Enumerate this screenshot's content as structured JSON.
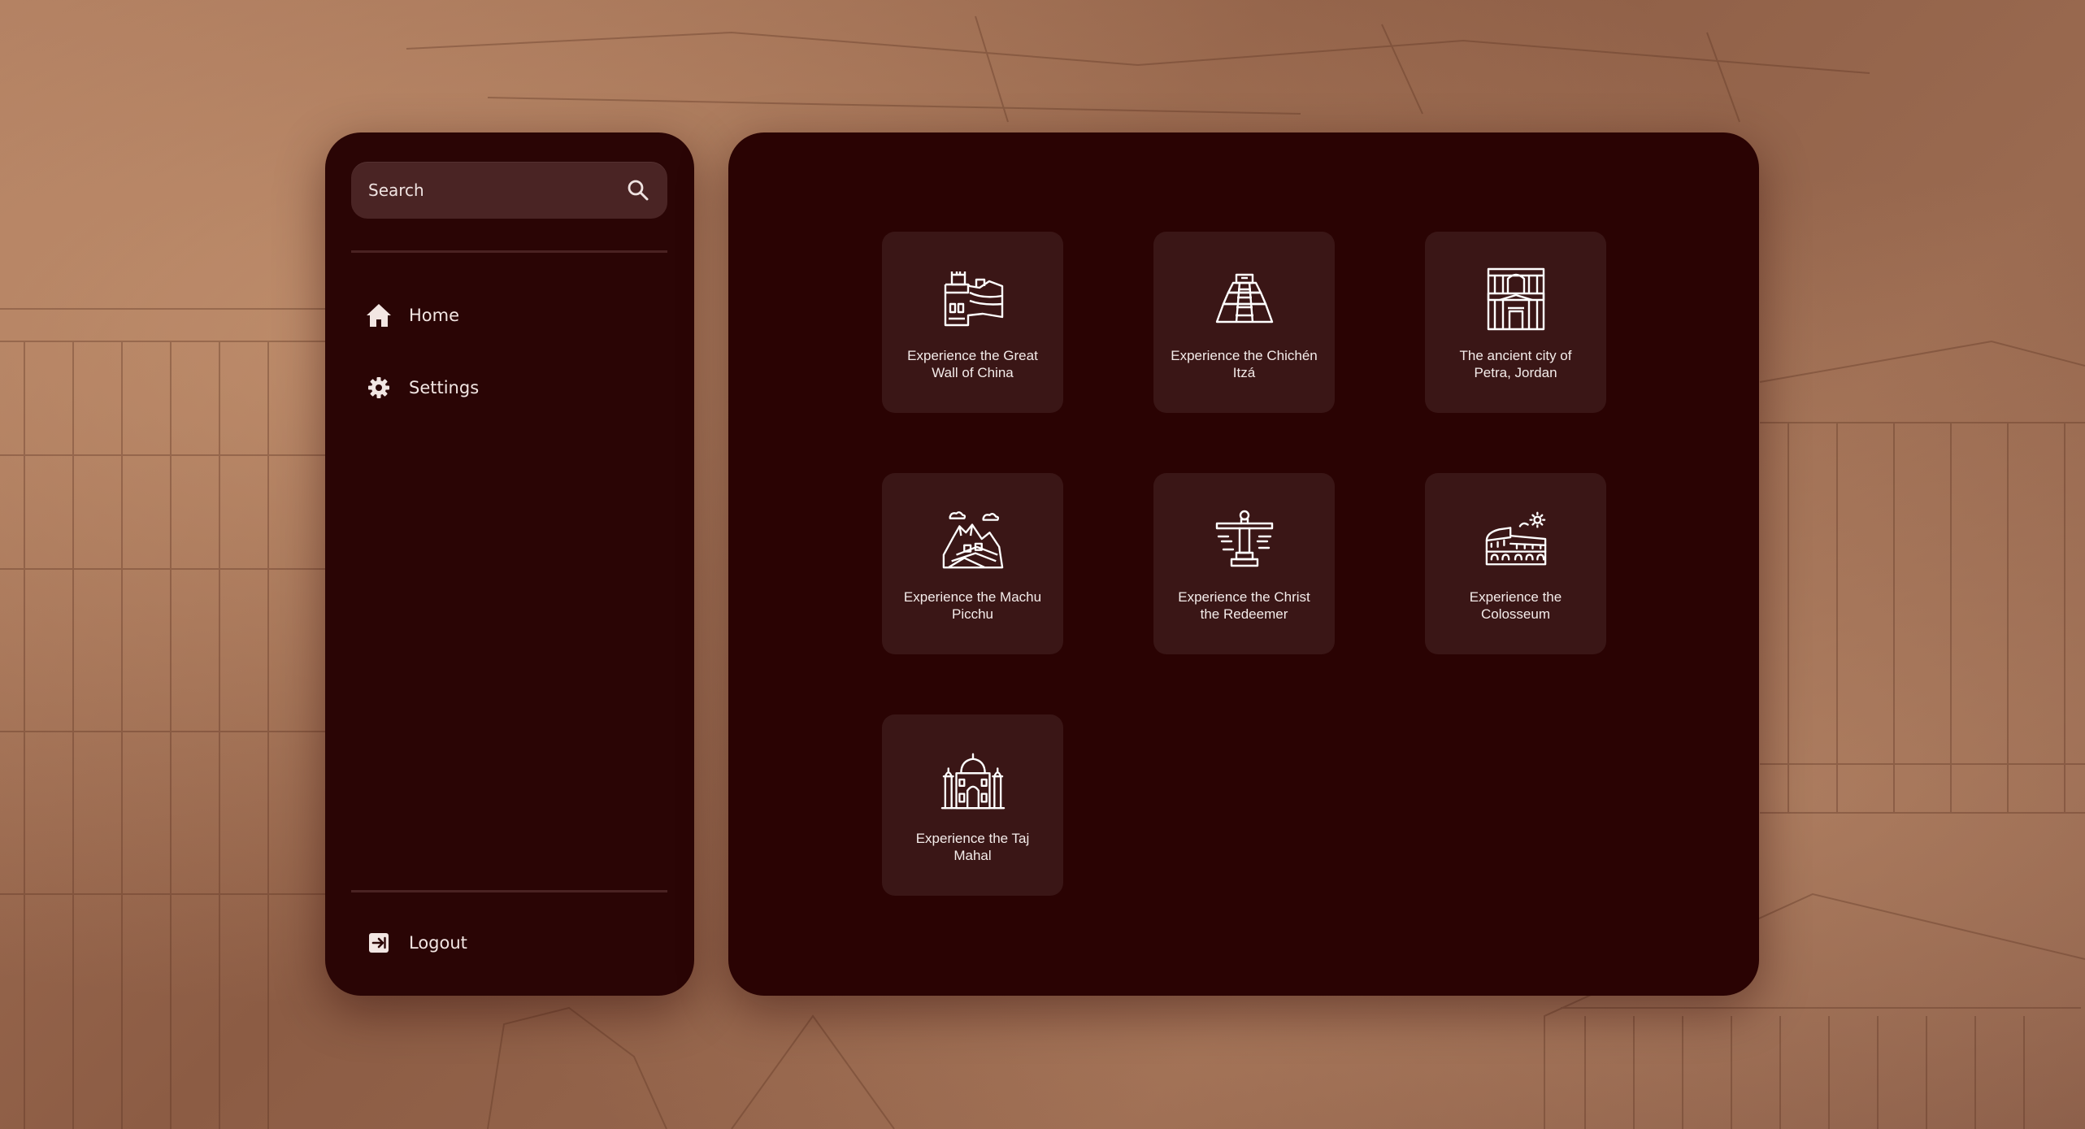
{
  "sidebar": {
    "search": {
      "placeholder": "Search",
      "icon": "search-icon"
    },
    "nav": [
      {
        "label": "Home",
        "icon": "home-icon"
      },
      {
        "label": "Settings",
        "icon": "gear-icon"
      }
    ],
    "logout": {
      "label": "Logout",
      "icon": "logout-icon"
    }
  },
  "cards": [
    {
      "title": "Experience the Great Wall of China",
      "icon": "great-wall-icon"
    },
    {
      "title": "Experience the Chichén Itzá",
      "icon": "pyramid-icon"
    },
    {
      "title": "The ancient city of Petra, Jordan",
      "icon": "petra-icon"
    },
    {
      "title": "Experience the Machu Picchu",
      "icon": "machu-picchu-icon"
    },
    {
      "title": "Experience the Christ the Redeemer",
      "icon": "christ-redeemer-icon"
    },
    {
      "title": "Experience the Colosseum",
      "icon": "colosseum-icon"
    },
    {
      "title": "Experience the Taj Mahal",
      "icon": "taj-mahal-icon"
    }
  ],
  "colors": {
    "panel": "#2a0303",
    "card": "#3a1616",
    "search_bg": "#4a2424",
    "text": "#f4ecea",
    "background": "#9a6a50"
  }
}
